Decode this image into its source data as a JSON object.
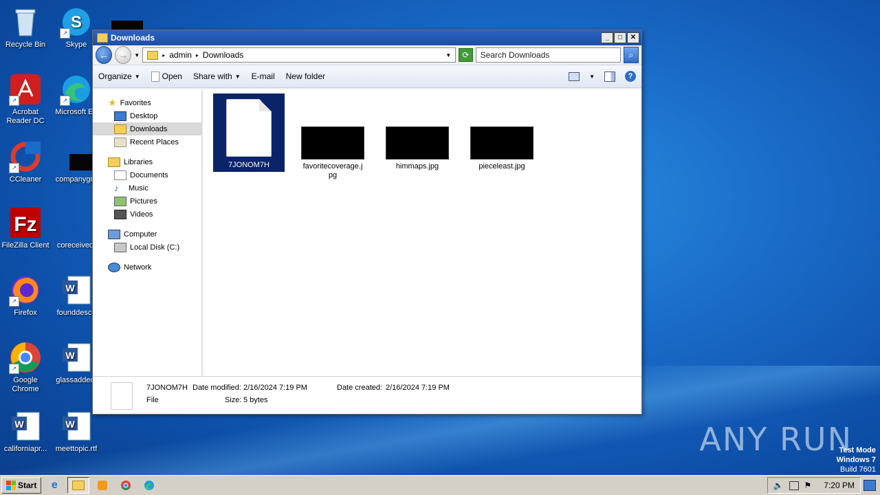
{
  "desktop": {
    "icons": [
      {
        "label": "Recycle Bin"
      },
      {
        "label": "Skype"
      },
      {
        "label": "Acrobat Reader DC"
      },
      {
        "label": "Microsoft Ed"
      },
      {
        "label": "CCleaner"
      },
      {
        "label": "companygro"
      },
      {
        "label": "FileZilla Client"
      },
      {
        "label": "coreceived."
      },
      {
        "label": "Firefox"
      },
      {
        "label": "founddescri"
      },
      {
        "label": "Google Chrome"
      },
      {
        "label": "glassadded."
      },
      {
        "label": "californiapr..."
      },
      {
        "label": "meettopic.rtf"
      }
    ]
  },
  "window": {
    "title": "Downloads",
    "address": {
      "segments": [
        "admin",
        "Downloads"
      ]
    },
    "search": {
      "placeholder": "Search Downloads"
    },
    "toolbar": {
      "organize": "Organize",
      "open": "Open",
      "share_with": "Share with",
      "email": "E-mail",
      "new_folder": "New folder"
    },
    "nav": {
      "favorites": "Favorites",
      "desktop": "Desktop",
      "downloads": "Downloads",
      "recent_places": "Recent Places",
      "libraries": "Libraries",
      "documents": "Documents",
      "music": "Music",
      "pictures": "Pictures",
      "videos": "Videos",
      "computer": "Computer",
      "local_disk": "Local Disk (C:)",
      "network": "Network"
    },
    "files": [
      {
        "name": "7JONOM7H"
      },
      {
        "name": "favoritecoverage.jpg"
      },
      {
        "name": "himmaps.jpg"
      },
      {
        "name": "pieceleast.jpg"
      }
    ],
    "details": {
      "name": "7JONOM7H",
      "type": "File",
      "date_modified_label": "Date modified:",
      "date_modified": "2/16/2024 7:19 PM",
      "date_created_label": "Date created:",
      "date_created": "2/16/2024 7:19 PM",
      "size_label": "Size:",
      "size": "5 bytes"
    }
  },
  "taskbar": {
    "start": "Start",
    "clock": "7:20 PM"
  },
  "overlay": {
    "watermark": "ANY RUN",
    "test_mode": "Test Mode",
    "os": "Windows 7",
    "build": "Build 7601"
  },
  "colors": {
    "selection": "#0a246a",
    "titlebar": "#1c4fa5",
    "desktop": "#1a6cc9"
  }
}
